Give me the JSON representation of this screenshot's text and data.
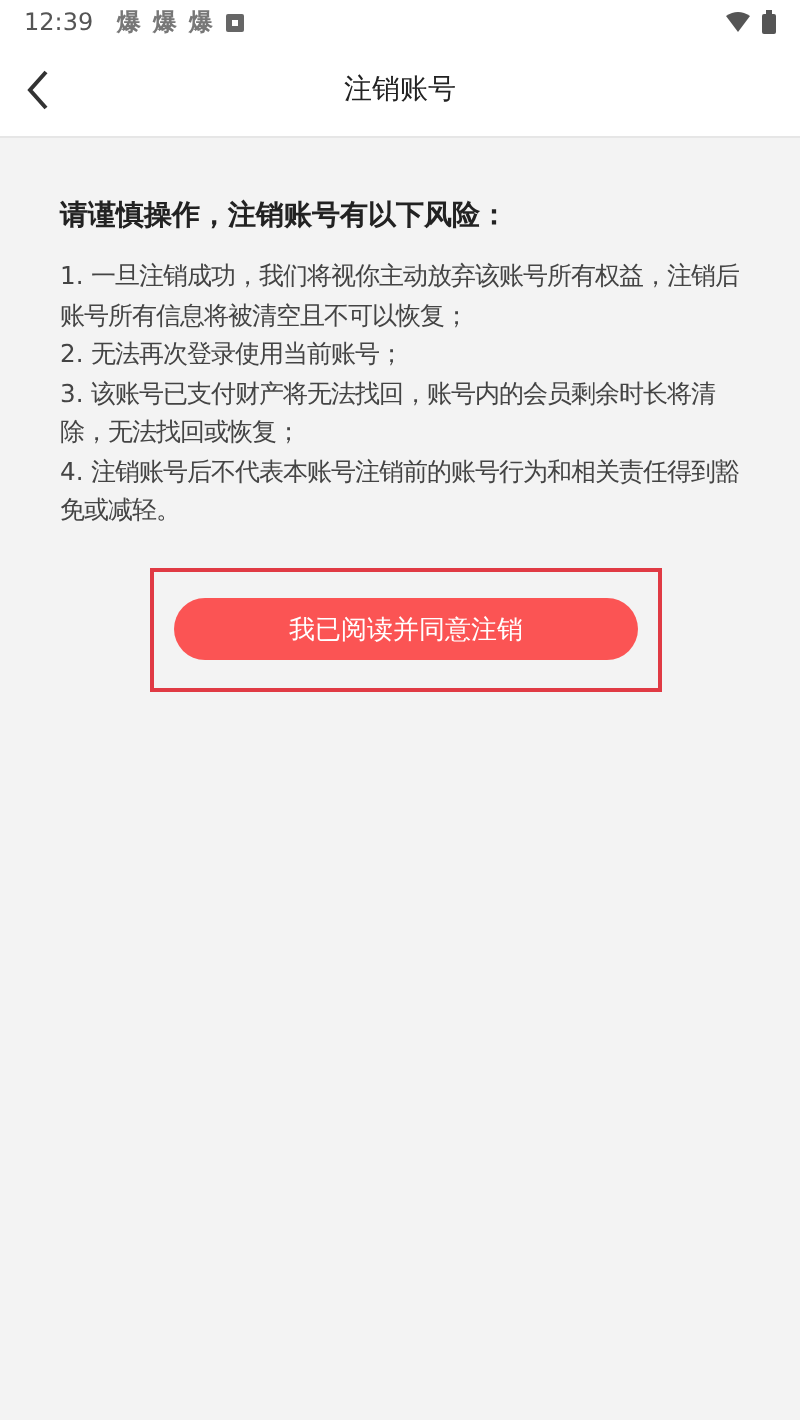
{
  "status_bar": {
    "time": "12:39",
    "notification_icons": [
      "爆",
      "爆",
      "爆"
    ]
  },
  "header": {
    "title": "注销账号"
  },
  "warning": {
    "heading": "请谨慎操作，注销账号有以下风险：",
    "items": [
      " 1. 一旦注销成功，我们将视你主动放弃该账号所有权益，注销后账号所有信息将被清空且不可以恢复；",
      "2. 无法再次登录使用当前账号；",
      "3. 该账号已支付财产将无法找回，账号内的会员剩余时长将清除，无法找回或恢复；",
      "4. 注销账号后不代表本账号注销前的账号行为和相关责任得到豁免或减轻。"
    ]
  },
  "confirm_button": {
    "label": "我已阅读并同意注销",
    "highlighted": true
  }
}
